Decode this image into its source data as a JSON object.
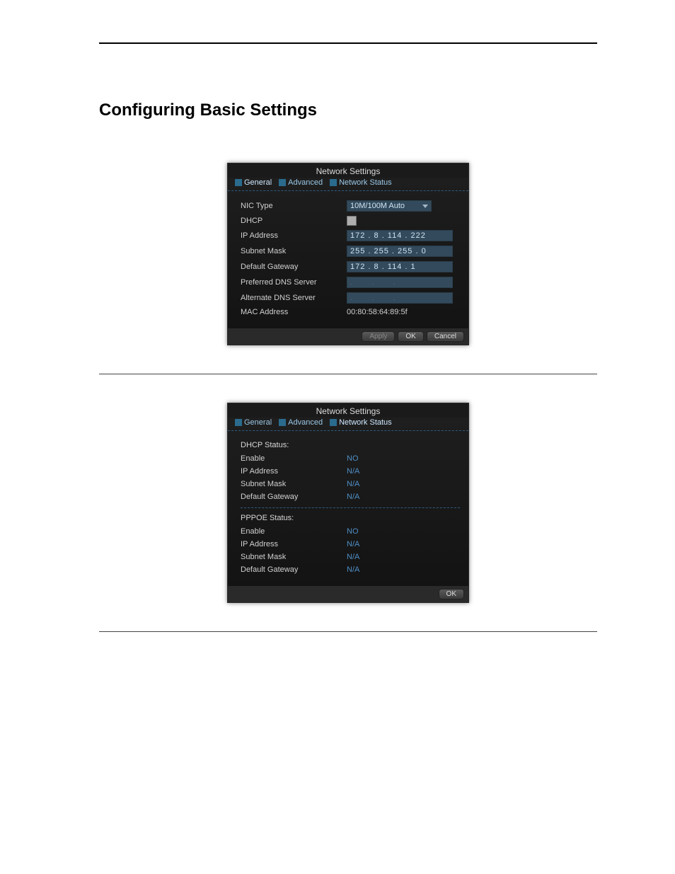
{
  "heading": "Configuring Basic Settings",
  "dialog1": {
    "title": "Network Settings",
    "tabs": [
      "General",
      "Advanced",
      "Network Status"
    ],
    "activeTab": 0,
    "labels": {
      "nicType": "NIC Type",
      "dhcp": "DHCP",
      "ip": "IP Address",
      "subnet": "Subnet Mask",
      "gateway": "Default Gateway",
      "prefDns": "Preferred DNS Server",
      "altDns": "Alternate DNS Server",
      "mac": "MAC Address"
    },
    "values": {
      "nicType": "10M/100M Auto",
      "ip": "172 . 8     . 114 . 222",
      "subnet": "255 . 255 . 255 . 0",
      "gateway": "172 . 8     . 114 . 1",
      "prefDns": ".  .  .",
      "altDns": ".  .  .",
      "mac": "00:80:58:64:89:5f"
    },
    "buttons": {
      "apply": "Apply",
      "ok": "OK",
      "cancel": "Cancel"
    }
  },
  "dialog2": {
    "title": "Network Settings",
    "tabs": [
      "General",
      "Advanced",
      "Network Status"
    ],
    "activeTab": 2,
    "dhcpHeader": "DHCP Status:",
    "pppoeHeader": "PPPOE Status:",
    "labels": {
      "enable": "Enable",
      "ip": "IP Address",
      "subnet": "Subnet Mask",
      "gateway": "Default Gateway"
    },
    "dhcp": {
      "enable": "NO",
      "ip": "N/A",
      "subnet": "N/A",
      "gateway": "N/A"
    },
    "pppoe": {
      "enable": "NO",
      "ip": "N/A",
      "subnet": "N/A",
      "gateway": "N/A"
    },
    "buttons": {
      "ok": "OK"
    }
  }
}
